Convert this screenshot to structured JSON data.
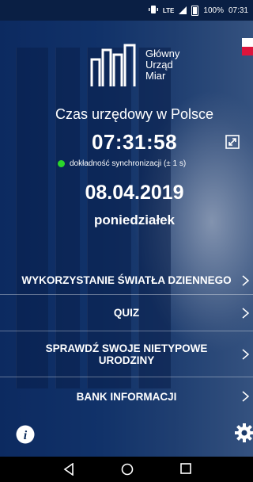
{
  "status_bar": {
    "network": "LTE",
    "battery_percent": "100%",
    "time": "07:31"
  },
  "logo": {
    "line1": "Główny",
    "line2": "Urząd",
    "line3": "Miar"
  },
  "header": {
    "title": "Czas urzędowy w Polsce",
    "time": "07:31:58",
    "sync_text": "dokładność synchronizacji (± 1 s)",
    "date": "08.04.2019",
    "weekday": "poniedziałek"
  },
  "menu": {
    "items": [
      {
        "label": "WYKORZYSTANIE ŚWIATŁA DZIENNEGO"
      },
      {
        "label": "QUIZ"
      },
      {
        "label": "SPRAWDŹ SWOJE NIETYPOWE URODZINY"
      },
      {
        "label": "BANK INFORMACJI"
      }
    ]
  },
  "colors": {
    "background": "#0b2a5a",
    "sync_dot": "#2bd62b",
    "flag_red": "#dc143c"
  },
  "icons": {
    "info": "info-icon",
    "settings": "gear-icon",
    "expand": "expand-icon",
    "back": "back-icon",
    "home": "home-icon",
    "recents": "recents-icon"
  }
}
